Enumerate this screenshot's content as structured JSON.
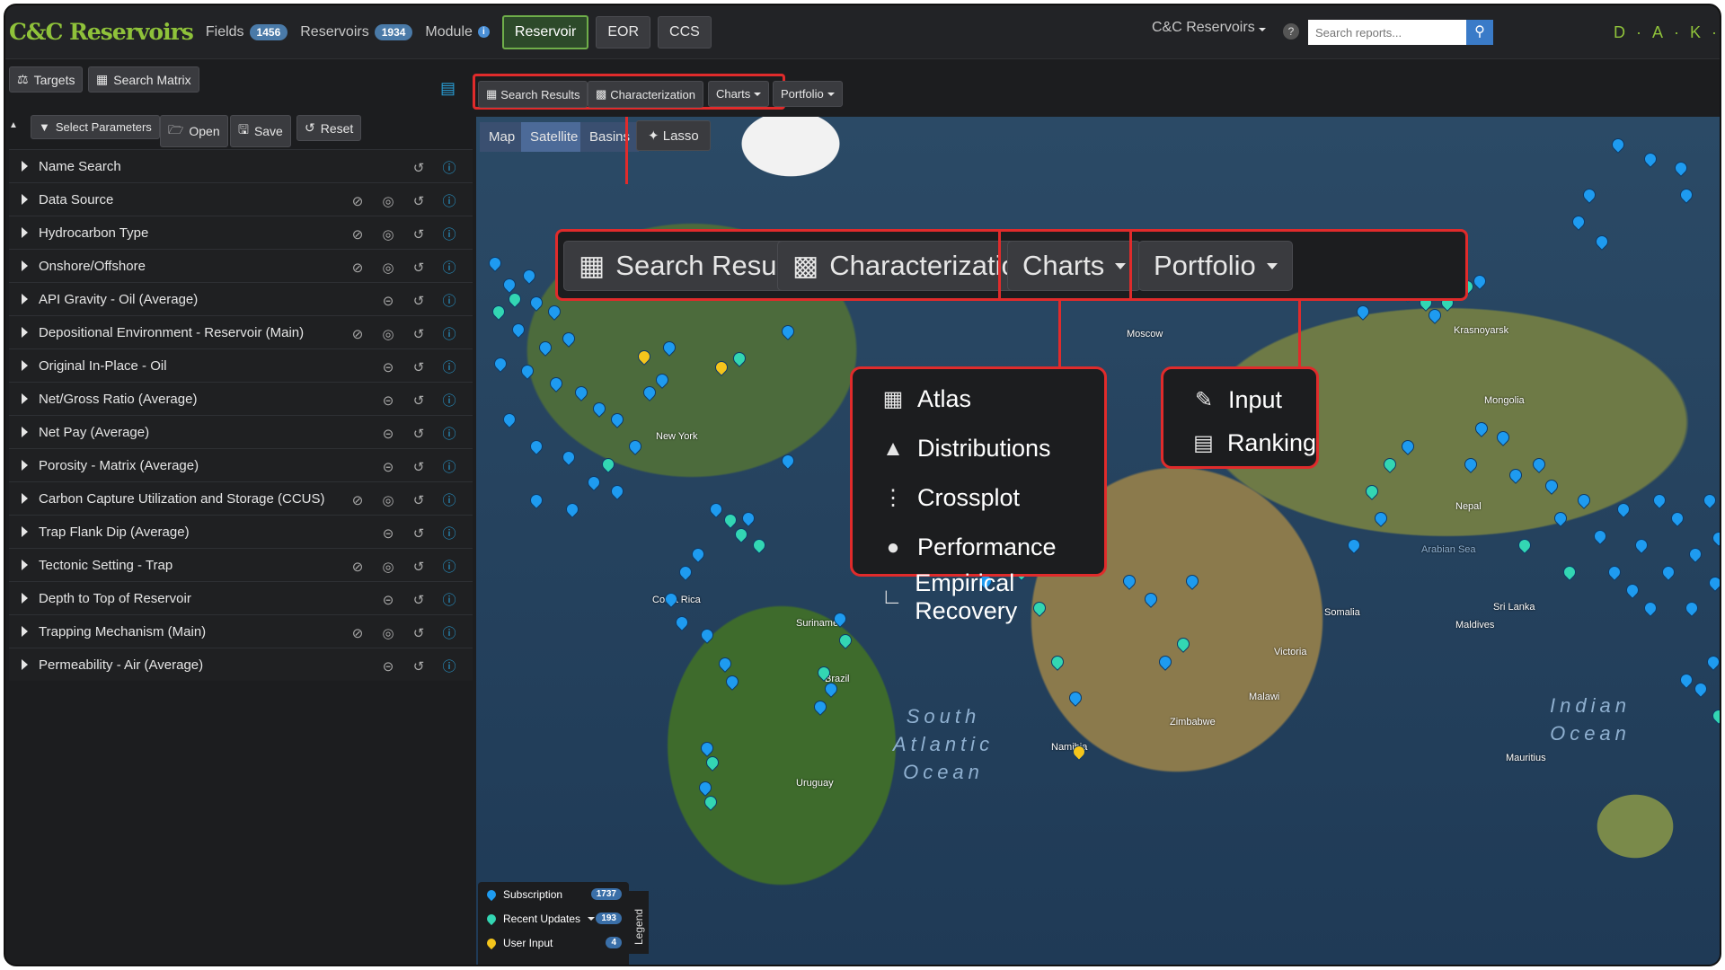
{
  "brand": "C&C Reservoirs",
  "nav": {
    "fields_label": "Fields",
    "fields_count": "1456",
    "reservoirs_label": "Reservoirs",
    "reservoirs_count": "1934",
    "module_label": "Module",
    "modules": [
      "Reservoir",
      "EOR",
      "CCS"
    ],
    "active_module": "Reservoir"
  },
  "org_menu": "C&C Reservoirs",
  "search": {
    "placeholder": "Search reports..."
  },
  "daks": "D·A·K·S",
  "left_toolbar": {
    "targets": "Targets",
    "search_matrix": "Search Matrix",
    "select_parameters": "Select Parameters",
    "open": "Open",
    "save": "Save",
    "reset": "Reset"
  },
  "parameters": [
    {
      "label": "Name Search",
      "icons": "short"
    },
    {
      "label": "Data Source",
      "icons": "full"
    },
    {
      "label": "Hydrocarbon Type",
      "icons": "full"
    },
    {
      "label": "Onshore/Offshore",
      "icons": "full"
    },
    {
      "label": "API Gravity - Oil (Average)",
      "icons": "range"
    },
    {
      "label": "Depositional Environment - Reservoir (Main)",
      "icons": "full"
    },
    {
      "label": "Original In-Place - Oil",
      "icons": "range"
    },
    {
      "label": "Net/Gross Ratio (Average)",
      "icons": "range"
    },
    {
      "label": "Net Pay (Average)",
      "icons": "range"
    },
    {
      "label": "Porosity - Matrix (Average)",
      "icons": "range"
    },
    {
      "label": "Carbon Capture Utilization and Storage (CCUS)",
      "icons": "full"
    },
    {
      "label": "Trap Flank Dip (Average)",
      "icons": "range"
    },
    {
      "label": "Tectonic Setting - Trap",
      "icons": "full"
    },
    {
      "label": "Depth to Top of Reservoir",
      "icons": "range"
    },
    {
      "label": "Trapping Mechanism (Main)",
      "icons": "full"
    },
    {
      "label": "Permeability - Air (Average)",
      "icons": "range"
    }
  ],
  "map_toolbar": {
    "search_results": "Search Results",
    "characterization": "Characterization",
    "charts": "Charts",
    "portfolio": "Portfolio"
  },
  "map_types": [
    "Map",
    "Satellite",
    "Basins"
  ],
  "active_map_type": "Satellite",
  "lasso": "Lasso",
  "charts_menu": [
    "Atlas",
    "Distributions",
    "Crossplot",
    "Performance",
    "Empirical Recovery"
  ],
  "portfolio_menu": [
    "Input",
    "Ranking"
  ],
  "map_labels": {
    "new_york": "New York",
    "costa_rica": "Costa Rica",
    "suriname": "Suriname",
    "brazil": "Brazil",
    "uruguay": "Uruguay",
    "moscow": "Moscow",
    "krasnoyarsk": "Krasnoyarsk",
    "mongolia": "Mongolia",
    "nepal": "Nepal",
    "sri_lanka": "Sri Lanka",
    "maldives": "Maldives",
    "somalia": "Somalia",
    "victoria": "Victoria",
    "malawi": "Malawi",
    "zimbabwe": "Zimbabwe",
    "namibia": "Namibia",
    "mauritius": "Mauritius",
    "arabian_sea": "Arabian Sea",
    "south_atlantic": "South Atlantic Ocean",
    "indian_ocean": "Indian Ocean"
  },
  "legend": {
    "title": "Legend",
    "items": [
      {
        "label": "Subscription",
        "count": "1737",
        "color": "#1e9bf0"
      },
      {
        "label": "Recent Updates",
        "count": "193",
        "color": "#33d6b3"
      },
      {
        "label": "User Input",
        "count": "4",
        "color": "#f4c51c"
      }
    ]
  },
  "colors": {
    "highlight": "#e02b2b",
    "brand": "#8fc23a",
    "info": "#29a0d8"
  }
}
